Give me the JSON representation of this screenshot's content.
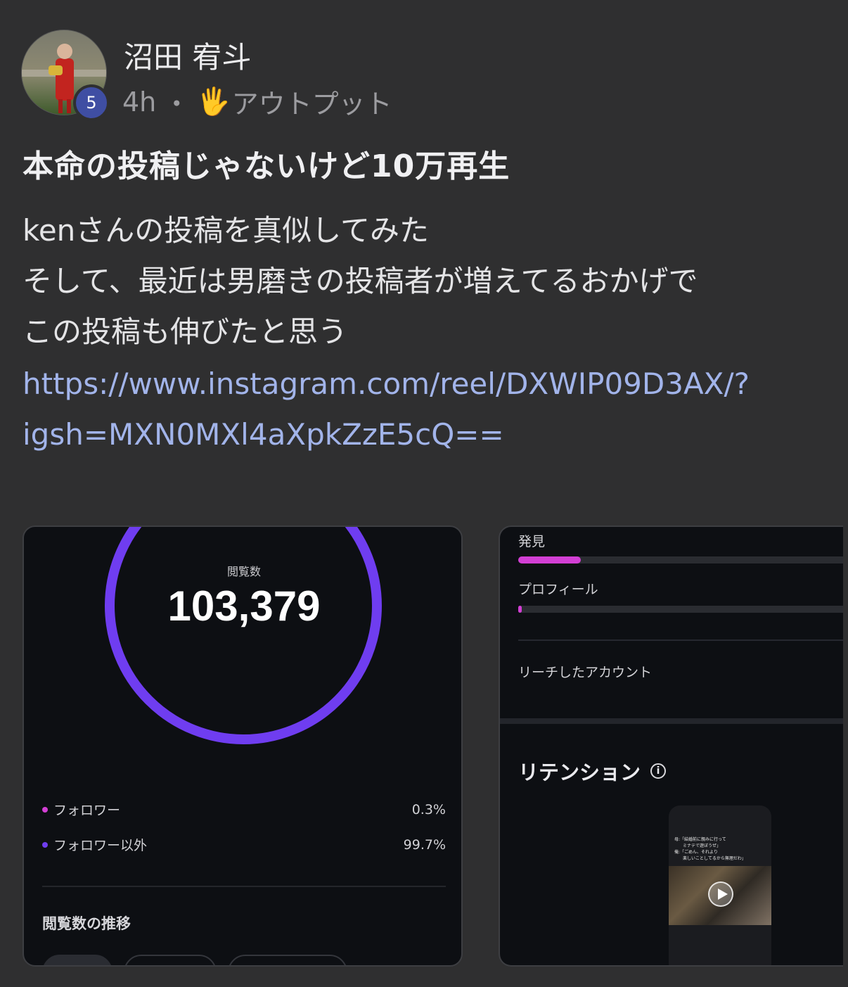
{
  "post": {
    "author": "沼田 宥斗",
    "level": "5",
    "time": "4h",
    "separator": "・",
    "category_icon": "🖐",
    "category": "アウトプット",
    "title": "本命の投稿じゃないけど10万再生",
    "body_lines": [
      "kenさんの投稿を真似してみた",
      "そして、最近は男磨きの投稿者が増えてるおかげで",
      "この投稿も伸びたと思う"
    ],
    "link_lines": [
      "https://www.instagram.com/reel/DXWIP09D3AX/?",
      "igsh=MXN0MXl4aXpkZzE5cQ=="
    ]
  },
  "insights_card": {
    "views_label": "閲覧数",
    "views_value": "103,379",
    "ring_color": "#6f3df0",
    "legend": [
      {
        "label": "フォロワー",
        "value": "0.3%",
        "color": "#d23fd4"
      },
      {
        "label": "フォロワー以外",
        "value": "99.7%",
        "color": "#6f3df0"
      }
    ],
    "trend_title": "閲覧数の推移"
  },
  "reach_card": {
    "discover_label": "発見",
    "discover_level": 0.19,
    "profile_label": "プロフィール",
    "profile_level": 0.01,
    "reached_label": "リーチしたアカウント",
    "retention_title": "リテンション",
    "info_icon": "info-icon",
    "thumbnail_caption_lines": [
      "母:「結婚前に親みに行って",
      "　　ミナテで遊ぼうぜ」",
      "俺:「ごめん、それより",
      "　　楽しいことしてるから無理だわ」"
    ]
  }
}
